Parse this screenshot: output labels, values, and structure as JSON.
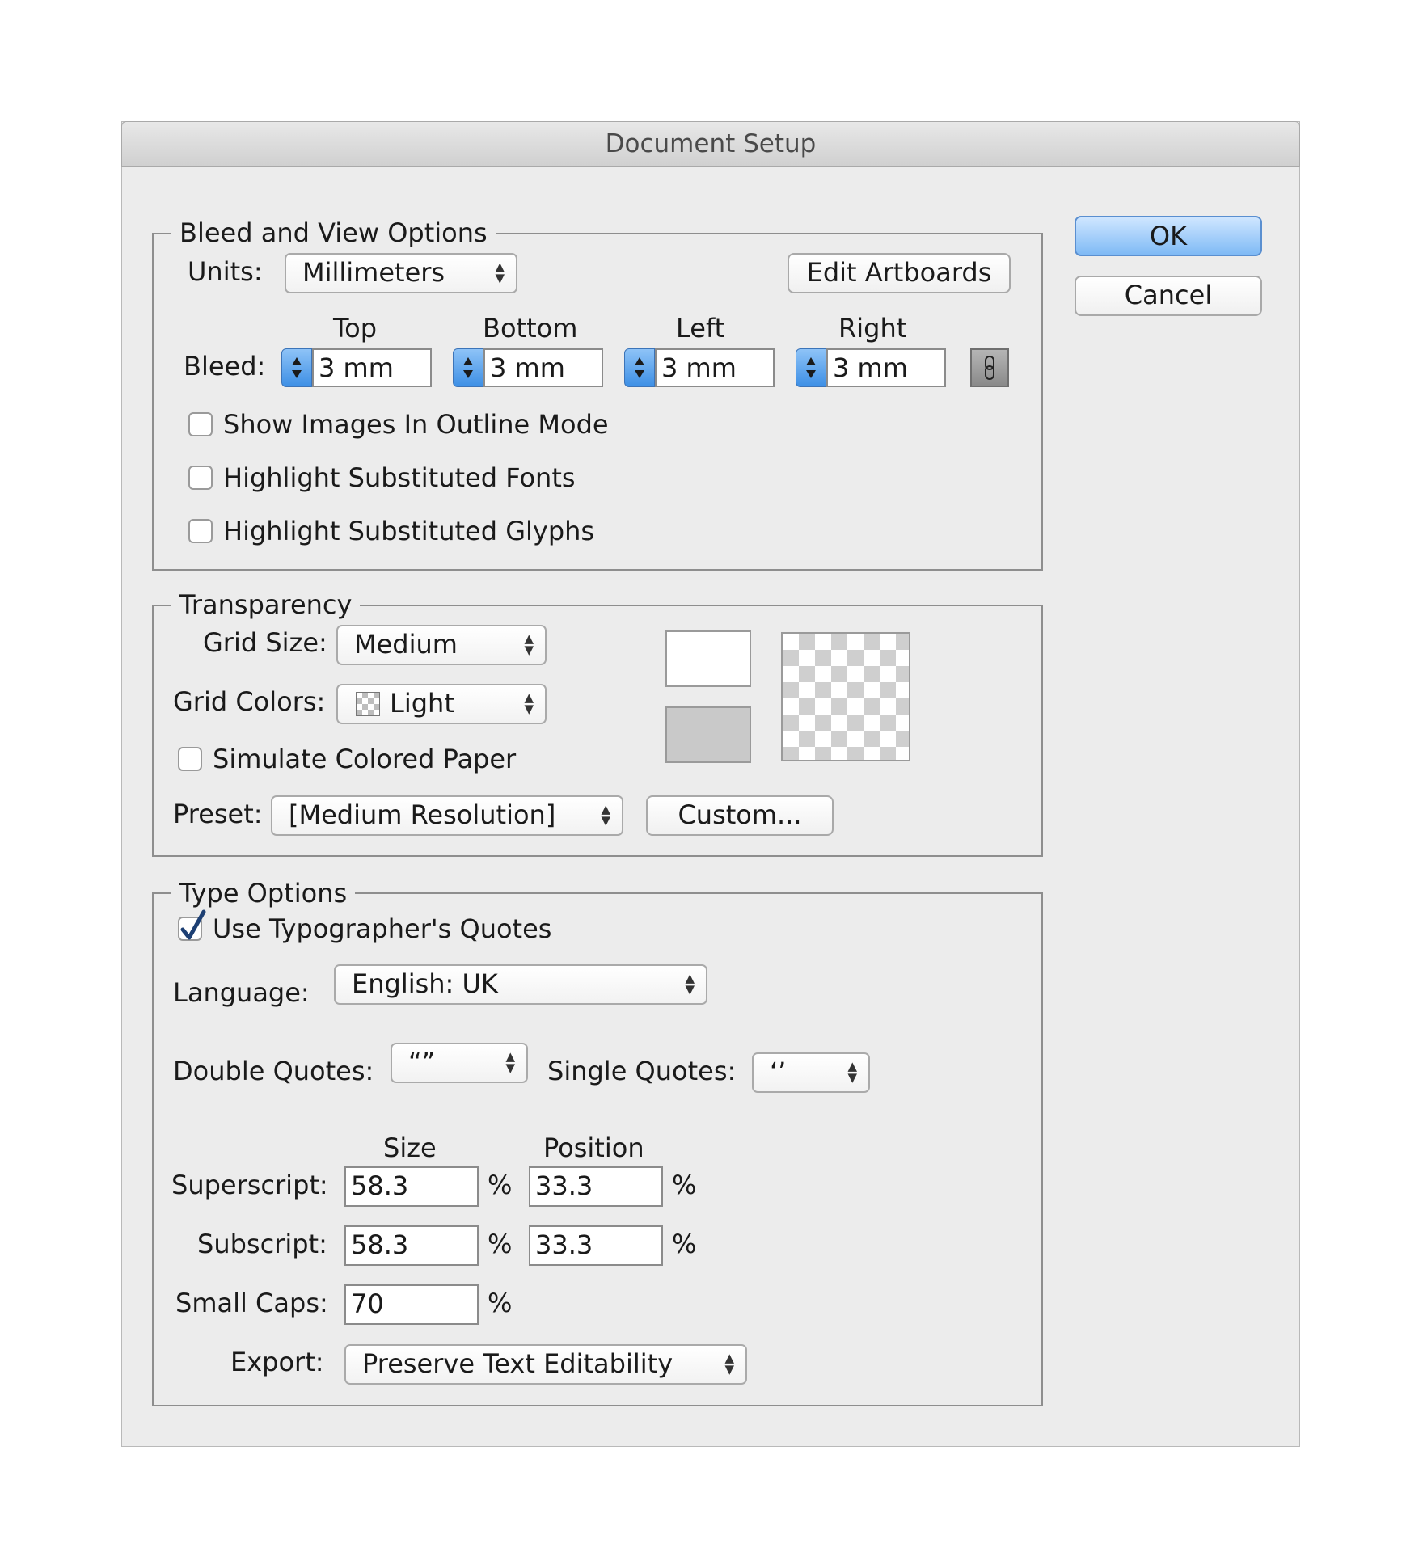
{
  "dialog": {
    "title": "Document Setup",
    "ok_label": "OK",
    "cancel_label": "Cancel"
  },
  "bleed_view": {
    "legend": "Bleed and View Options",
    "units_label": "Units:",
    "units_value": "Millimeters",
    "edit_artboards_label": "Edit Artboards",
    "bleed_label": "Bleed:",
    "top_label": "Top",
    "bottom_label": "Bottom",
    "left_label": "Left",
    "right_label": "Right",
    "top_value": "3 mm",
    "bottom_value": "3 mm",
    "left_value": "3 mm",
    "right_value": "3 mm",
    "show_images_outline": "Show Images In Outline Mode",
    "highlight_fonts": "Highlight Substituted Fonts",
    "highlight_glyphs": "Highlight Substituted Glyphs"
  },
  "transparency": {
    "legend": "Transparency",
    "grid_size_label": "Grid Size:",
    "grid_size_value": "Medium",
    "grid_colors_label": "Grid Colors:",
    "grid_colors_value": "Light",
    "simulate_paper": "Simulate Colored Paper",
    "preset_label": "Preset:",
    "preset_value": "[Medium Resolution]",
    "custom_label": "Custom..."
  },
  "type_options": {
    "legend": "Type Options",
    "typographers_quotes": "Use Typographer's Quotes",
    "typographers_quotes_checked": true,
    "language_label": "Language:",
    "language_value": "English: UK",
    "double_quotes_label": "Double Quotes:",
    "double_quotes_value": "“”",
    "single_quotes_label": "Single Quotes:",
    "single_quotes_value": "‘’",
    "size_header": "Size",
    "position_header": "Position",
    "superscript_label": "Superscript:",
    "superscript_size": "58.3",
    "superscript_position": "33.3",
    "subscript_label": "Subscript:",
    "subscript_size": "58.3",
    "subscript_position": "33.3",
    "small_caps_label": "Small Caps:",
    "small_caps_value": "70",
    "percent": "%",
    "export_label": "Export:",
    "export_value": "Preserve Text Editability"
  }
}
